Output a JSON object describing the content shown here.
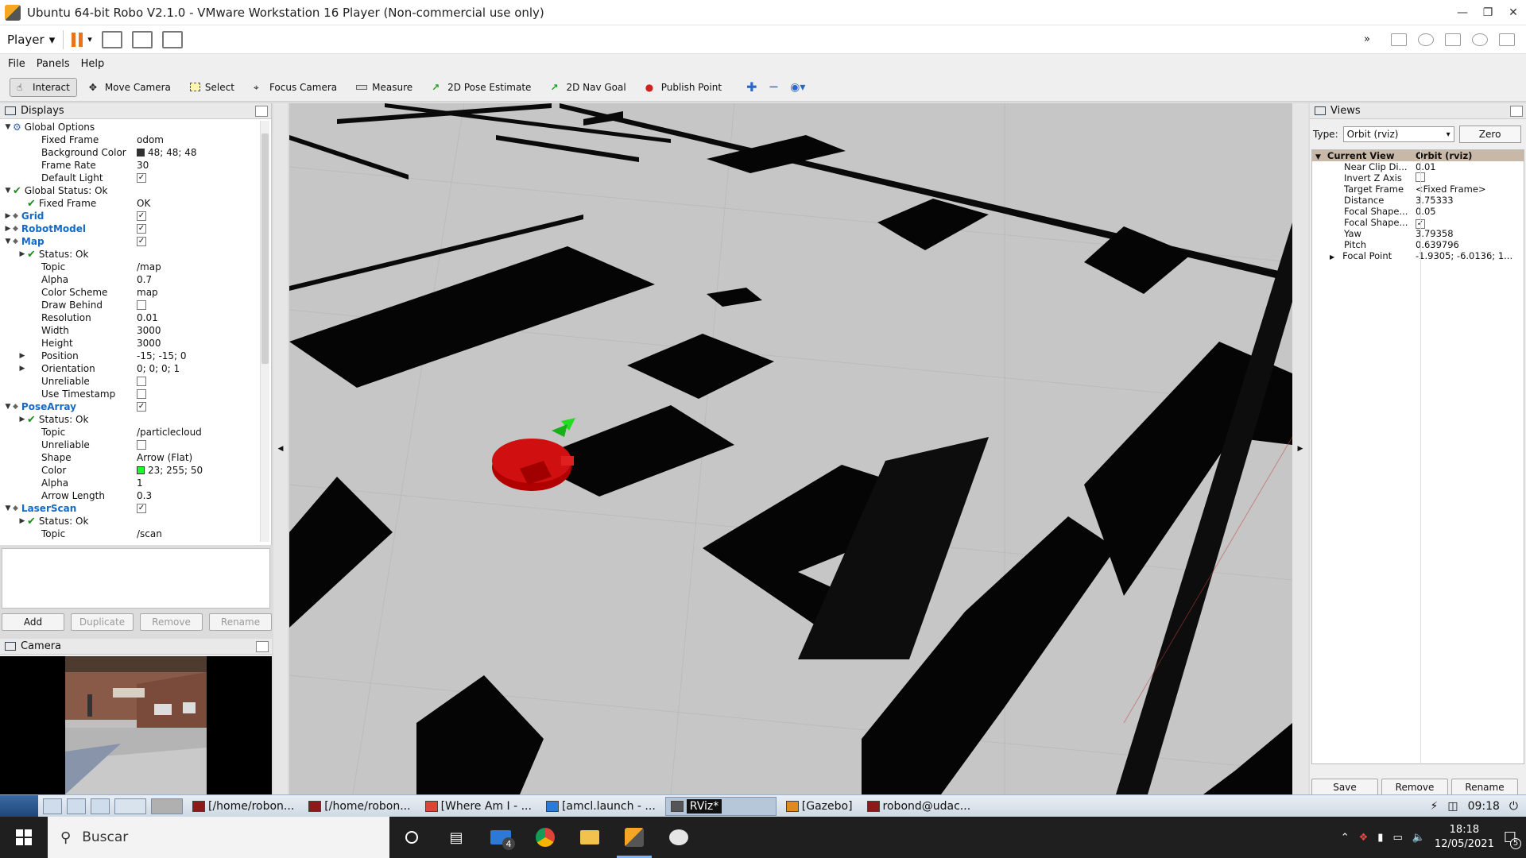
{
  "window": {
    "title": "Ubuntu 64-bit Robo V2.1.0 - VMware Workstation 16 Player (Non-commercial use only)"
  },
  "vm_toolbar": {
    "player_label": "Player"
  },
  "menubar": [
    "File",
    "Panels",
    "Help"
  ],
  "tools": [
    {
      "label": "Interact",
      "icon": "interact-icon",
      "active": true
    },
    {
      "label": "Move Camera",
      "icon": "move-camera-icon"
    },
    {
      "label": "Select",
      "icon": "select-icon"
    },
    {
      "label": "Focus Camera",
      "icon": "focus-camera-icon"
    },
    {
      "label": "Measure",
      "icon": "measure-icon"
    },
    {
      "label": "2D Pose Estimate",
      "icon": "pose-estimate-icon"
    },
    {
      "label": "2D Nav Goal",
      "icon": "nav-goal-icon"
    },
    {
      "label": "Publish Point",
      "icon": "publish-point-icon"
    }
  ],
  "displays": {
    "title": "Displays",
    "rows": [
      {
        "name": "Global Options",
        "value": "",
        "indent": 0,
        "arrow": "open",
        "icon": "gear"
      },
      {
        "name": "Fixed Frame",
        "value": "odom",
        "indent": 1
      },
      {
        "name": "Background Color",
        "value": "48; 48; 48",
        "indent": 1,
        "swatch": "#303030"
      },
      {
        "name": "Frame Rate",
        "value": "30",
        "indent": 1
      },
      {
        "name": "Default Light",
        "value": "",
        "indent": 1,
        "checkbox": true
      },
      {
        "name": "Global Status: Ok",
        "value": "",
        "indent": 0,
        "arrow": "open",
        "check": true
      },
      {
        "name": "Fixed Frame",
        "value": "OK",
        "indent": 1,
        "check": true
      },
      {
        "name": "Grid",
        "value": "",
        "indent": 0,
        "arrow": "closed",
        "blue": true,
        "checkbox": true
      },
      {
        "name": "RobotModel",
        "value": "",
        "indent": 0,
        "arrow": "closed",
        "blue": true,
        "checkbox": true
      },
      {
        "name": "Map",
        "value": "",
        "indent": 0,
        "arrow": "open",
        "blue": true,
        "checkbox": true
      },
      {
        "name": "Status: Ok",
        "value": "",
        "indent": 1,
        "arrow": "closed",
        "check": true
      },
      {
        "name": "Topic",
        "value": "/map",
        "indent": 1
      },
      {
        "name": "Alpha",
        "value": "0.7",
        "indent": 1
      },
      {
        "name": "Color Scheme",
        "value": "map",
        "indent": 1
      },
      {
        "name": "Draw Behind",
        "value": "",
        "indent": 1,
        "checkbox": false
      },
      {
        "name": "Resolution",
        "value": "0.01",
        "indent": 1
      },
      {
        "name": "Width",
        "value": "3000",
        "indent": 1
      },
      {
        "name": "Height",
        "value": "3000",
        "indent": 1
      },
      {
        "name": "Position",
        "value": "-15; -15; 0",
        "indent": 1,
        "arrow": "closed"
      },
      {
        "name": "Orientation",
        "value": "0; 0; 0; 1",
        "indent": 1,
        "arrow": "closed"
      },
      {
        "name": "Unreliable",
        "value": "",
        "indent": 1,
        "checkbox": false
      },
      {
        "name": "Use Timestamp",
        "value": "",
        "indent": 1,
        "checkbox": false
      },
      {
        "name": "PoseArray",
        "value": "",
        "indent": 0,
        "arrow": "open",
        "blue": true,
        "checkbox": true
      },
      {
        "name": "Status: Ok",
        "value": "",
        "indent": 1,
        "arrow": "closed",
        "check": true
      },
      {
        "name": "Topic",
        "value": "/particlecloud",
        "indent": 1
      },
      {
        "name": "Unreliable",
        "value": "",
        "indent": 1,
        "checkbox": false
      },
      {
        "name": "Shape",
        "value": "Arrow (Flat)",
        "indent": 1
      },
      {
        "name": "Color",
        "value": "23; 255; 50",
        "indent": 1,
        "swatch": "#17ff32"
      },
      {
        "name": "Alpha",
        "value": "1",
        "indent": 1
      },
      {
        "name": "Arrow Length",
        "value": "0.3",
        "indent": 1
      },
      {
        "name": "LaserScan",
        "value": "",
        "indent": 0,
        "arrow": "open",
        "blue": true,
        "checkbox": true
      },
      {
        "name": "Status: Ok",
        "value": "",
        "indent": 1,
        "arrow": "closed",
        "check": true
      },
      {
        "name": "Topic",
        "value": "/scan",
        "indent": 1
      }
    ],
    "buttons": {
      "add": "Add",
      "duplicate": "Duplicate",
      "remove": "Remove",
      "rename": "Rename"
    }
  },
  "camera_panel": {
    "title": "Camera"
  },
  "views": {
    "title": "Views",
    "type_label": "Type:",
    "type_value": "Orbit (rviz)",
    "zero": "Zero",
    "current_view": {
      "name": "Current View",
      "value": "Orbit (rviz)"
    },
    "rows": [
      {
        "name": "Near Clip Di...",
        "value": "0.01"
      },
      {
        "name": "Invert Z Axis",
        "value": "",
        "checkbox": false
      },
      {
        "name": "Target Frame",
        "value": "<Fixed Frame>"
      },
      {
        "name": "Distance",
        "value": "3.75333"
      },
      {
        "name": "Focal Shape...",
        "value": "0.05"
      },
      {
        "name": "Focal Shape...",
        "value": "",
        "checkbox": true
      },
      {
        "name": "Yaw",
        "value": "3.79358"
      },
      {
        "name": "Pitch",
        "value": "0.639796"
      },
      {
        "name": "Focal Point",
        "value": "-1.9305; -6.0136; 1...",
        "arrow": true
      }
    ],
    "buttons": {
      "save": "Save",
      "remove": "Remove",
      "rename": "Rename"
    }
  },
  "guest_taskbar": {
    "tasks": [
      {
        "label": "[/home/robon...",
        "icon": "terminal-icon"
      },
      {
        "label": "[/home/robon...",
        "icon": "terminal-icon"
      },
      {
        "label": "[Where Am I - ...",
        "icon": "chrome-icon"
      },
      {
        "label": "[amcl.launch - ...",
        "icon": "vscode-icon"
      },
      {
        "label": "RViz*",
        "icon": "rviz-icon",
        "active": true
      },
      {
        "label": "[Gazebo]",
        "icon": "gazebo-icon"
      },
      {
        "label": "robond@udac...",
        "icon": "terminal-icon"
      }
    ],
    "time": "09:18"
  },
  "host_taskbar": {
    "search_placeholder": "Buscar",
    "mail_badge": "4",
    "time": "18:18",
    "date": "12/05/2021",
    "notification_count": "5"
  }
}
